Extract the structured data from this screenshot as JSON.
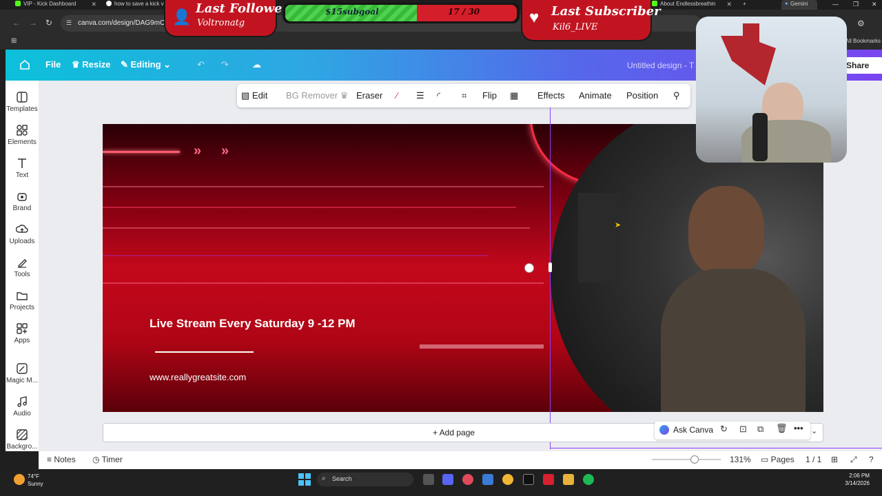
{
  "browser": {
    "tabs": [
      {
        "label": "VIP - Kick Dashboard",
        "color": "#53fc18"
      },
      {
        "label": "how to save a kick vo",
        "color": "#ffffff"
      },
      {
        "label": "About Endlessbreathin",
        "color": "#53fc18"
      },
      {
        "label": "Gemini",
        "color": "#7aa7ff"
      }
    ],
    "url": "canva.com/design/DAG9mOD8",
    "all_bookmarks": "All Bookmarks"
  },
  "canva": {
    "file_label": "File",
    "resize_label": "Resize",
    "editing_label": "Editing",
    "doc_title": "Untitled design - T",
    "share_label": "Share",
    "rail": [
      {
        "label": "Templates",
        "icon": "templates-icon"
      },
      {
        "label": "Elements",
        "icon": "elements-icon"
      },
      {
        "label": "Text",
        "icon": "text-icon"
      },
      {
        "label": "Brand",
        "icon": "brand-icon"
      },
      {
        "label": "Uploads",
        "icon": "uploads-icon"
      },
      {
        "label": "Tools",
        "icon": "tools-icon"
      },
      {
        "label": "Projects",
        "icon": "projects-icon"
      },
      {
        "label": "Apps",
        "icon": "apps-icon"
      },
      {
        "label": "Magic M...",
        "icon": "magic-media-icon"
      },
      {
        "label": "Audio",
        "icon": "audio-icon"
      },
      {
        "label": "Backgro...",
        "icon": "background-icon"
      }
    ],
    "toolbar": {
      "edit": "Edit",
      "bg_remover": "BG Remover",
      "eraser": "Eraser",
      "flip": "Flip",
      "effects": "Effects",
      "animate": "Animate",
      "position": "Position"
    },
    "design": {
      "headline": "Live Stream Every Saturday 9 -12 PM",
      "website": "www.reallygreatsite.com"
    },
    "add_page": "+ Add page",
    "ask_canva": "Ask Canva",
    "footer": {
      "notes": "Notes",
      "timer": "Timer",
      "zoom": "131%",
      "pages_label": "Pages",
      "pages_count": "1 / 1",
      "zoom_level": 0.62
    }
  },
  "taskbar": {
    "temp": "74°F",
    "condition": "Sunny",
    "search": "Search",
    "time": "2:06 PM",
    "date": "3/14/2026"
  },
  "overlays": {
    "follower_title": "Last Follower",
    "follower_name": "Voltronatg",
    "goal_label": "$15subgoal",
    "goal_count": "17 / 30",
    "goal_fraction": 0.567,
    "subscriber_title": "Last Subscriber",
    "subscriber_name": "Kil6_LIVE"
  },
  "colors": {
    "accent_purple": "#8b3dff",
    "overlay_red": "#c21420",
    "goal_green": "#4fd24f"
  }
}
